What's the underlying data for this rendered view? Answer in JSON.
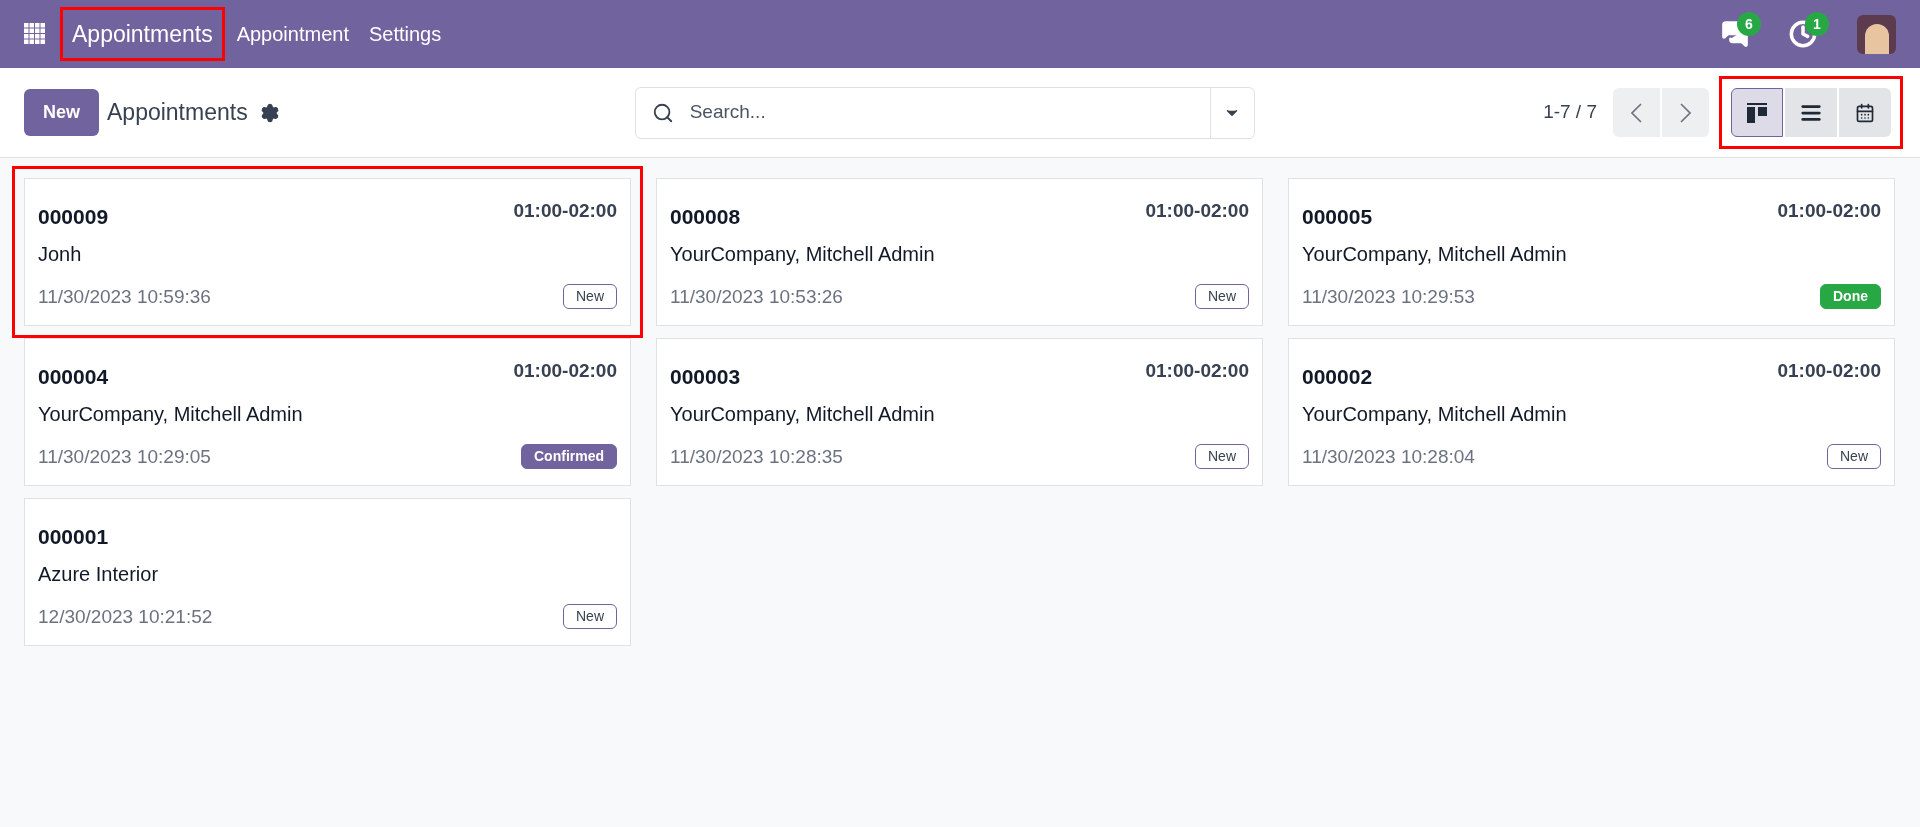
{
  "navbar": {
    "brand": {
      "label": "Appointments",
      "highlighted": true
    },
    "menu": [
      "Appointment",
      "Settings"
    ],
    "messages_count": "6",
    "activities_count": "1"
  },
  "control_panel": {
    "new_button": "New",
    "title": "Appointments",
    "search": {
      "placeholder": "Search..."
    },
    "pager": "1-7 / 7",
    "view_switcher": {
      "highlighted": true,
      "views": [
        {
          "kind": "kanban",
          "selected": true
        },
        {
          "kind": "list",
          "selected": false
        },
        {
          "kind": "calendar",
          "selected": false
        }
      ]
    }
  },
  "cards": [
    {
      "number": "000009",
      "time": "01:00-02:00",
      "partner": "Jonh",
      "date": "11/30/2023 10:59:36",
      "status": {
        "label": "New",
        "kind": "new"
      },
      "highlighted": true
    },
    {
      "number": "000008",
      "time": "01:00-02:00",
      "partner": "YourCompany, Mitchell Admin",
      "date": "11/30/2023 10:53:26",
      "status": {
        "label": "New",
        "kind": "new"
      },
      "highlighted": false
    },
    {
      "number": "000005",
      "time": "01:00-02:00",
      "partner": "YourCompany, Mitchell Admin",
      "date": "11/30/2023 10:29:53",
      "status": {
        "label": "Done",
        "kind": "done"
      },
      "highlighted": false
    },
    {
      "number": "000004",
      "time": "01:00-02:00",
      "partner": "YourCompany, Mitchell Admin",
      "date": "11/30/2023 10:29:05",
      "status": {
        "label": "Confirmed",
        "kind": "confirmed"
      },
      "highlighted": false
    },
    {
      "number": "000003",
      "time": "01:00-02:00",
      "partner": "YourCompany, Mitchell Admin",
      "date": "11/30/2023 10:28:35",
      "status": {
        "label": "New",
        "kind": "new"
      },
      "highlighted": false
    },
    {
      "number": "000002",
      "time": "01:00-02:00",
      "partner": "YourCompany, Mitchell Admin",
      "date": "11/30/2023 10:28:04",
      "status": {
        "label": "New",
        "kind": "new"
      },
      "highlighted": false
    },
    {
      "number": "000001",
      "partner": "Azure Interior",
      "date": "12/30/2023 10:21:52",
      "status": {
        "label": "New",
        "kind": "new"
      },
      "highlighted": false
    }
  ]
}
